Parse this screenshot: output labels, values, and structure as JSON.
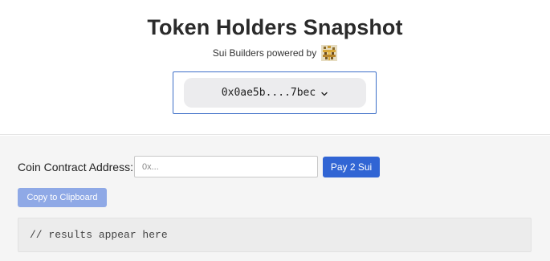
{
  "header": {
    "title": "Token Holders Snapshot",
    "subtitle": "Sui Builders powered by",
    "logo_icon": "pixel-art-logo-icon"
  },
  "wallet": {
    "address": "0x0ae5b....7bec",
    "icon": "chevron-down-icon"
  },
  "form": {
    "label": "Coin Contract Address:",
    "input_value": "",
    "input_placeholder": "0x...",
    "pay_label": "Pay 2 Sui",
    "copy_label": "Copy to Clipboard"
  },
  "results": {
    "text": "// results appear here"
  },
  "colors": {
    "primary": "#3165d4",
    "primary_disabled": "#8fa9e6",
    "wallet_border": "#3d6fc8",
    "panel_bg": "#f5f5f5"
  }
}
